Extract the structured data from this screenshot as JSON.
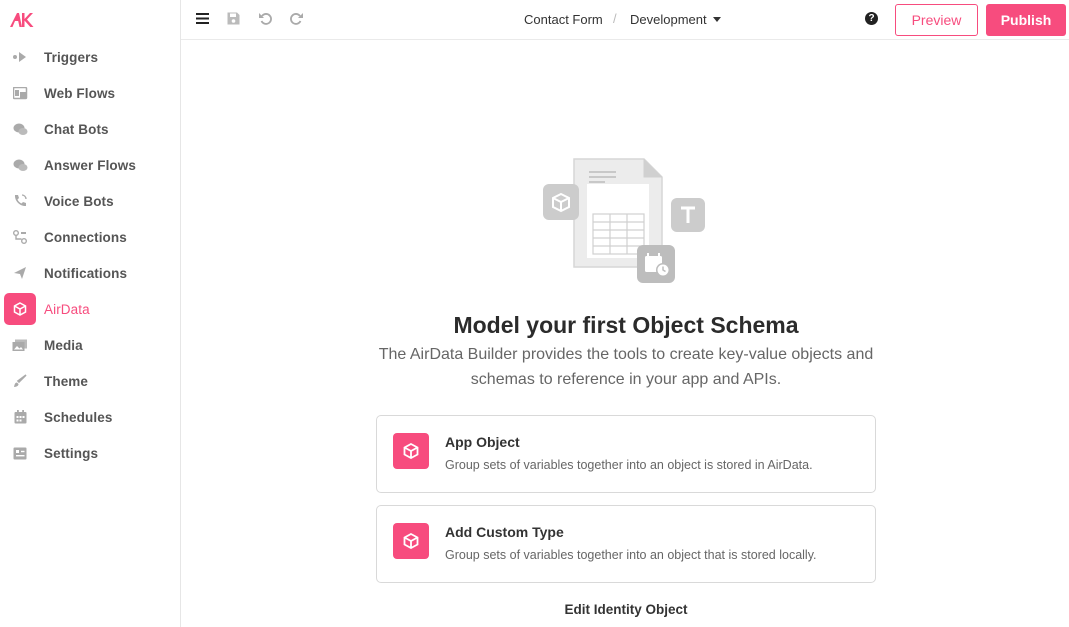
{
  "brand": {
    "logo_text": "AK",
    "accent": "#f74c7e"
  },
  "sidebar": {
    "items": [
      {
        "label": "Triggers",
        "icon": "triggers-icon",
        "active": false
      },
      {
        "label": "Web Flows",
        "icon": "web-flows-icon",
        "active": false
      },
      {
        "label": "Chat Bots",
        "icon": "chat-bubbles-icon",
        "active": false
      },
      {
        "label": "Answer Flows",
        "icon": "chat-bubbles-icon",
        "active": false
      },
      {
        "label": "Voice Bots",
        "icon": "phone-icon",
        "active": false
      },
      {
        "label": "Connections",
        "icon": "connections-icon",
        "active": false
      },
      {
        "label": "Notifications",
        "icon": "paper-plane-icon",
        "active": false
      },
      {
        "label": "AirData",
        "icon": "cube-icon",
        "active": true
      },
      {
        "label": "Media",
        "icon": "images-icon",
        "active": false
      },
      {
        "label": "Theme",
        "icon": "brush-icon",
        "active": false
      },
      {
        "label": "Schedules",
        "icon": "calendar-icon",
        "active": false
      },
      {
        "label": "Settings",
        "icon": "settings-icon",
        "active": false
      }
    ]
  },
  "toolbar": {
    "breadcrumb_project": "Contact Form",
    "breadcrumb_separator": "/",
    "environment": "Development",
    "help_label": "?",
    "preview_label": "Preview",
    "publish_label": "Publish"
  },
  "empty_state": {
    "title": "Model your first Object Schema",
    "subtitle": "The AirData Builder provides the tools to create key-value objects and schemas to reference in your app and APIs.",
    "cards": [
      {
        "title": "App Object",
        "description": "Group sets of variables together into an object is stored in AirData.",
        "icon": "cube-icon"
      },
      {
        "title": "Add Custom Type",
        "description": "Group sets of variables together into an object that is stored locally.",
        "icon": "cube-icon"
      }
    ],
    "edit_link": "Edit Identity Object"
  }
}
